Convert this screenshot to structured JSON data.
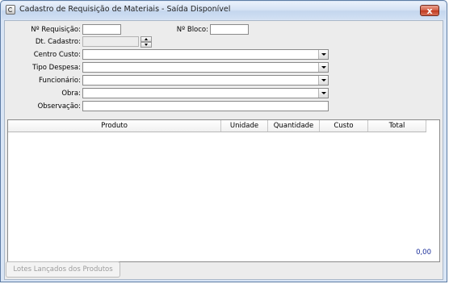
{
  "window": {
    "title": "Cadastro de Requisição de Materiais - Saída Disponível",
    "close_label": "x"
  },
  "form": {
    "requisicao_label": "Nº Requisição:",
    "bloco_label": "Nº Bloco:",
    "cadastro_label": "Dt. Cadastro:",
    "centro_custo_label": "Centro Custo:",
    "tipo_despesa_label": "Tipo Despesa:",
    "funcionario_label": "Funcionário:",
    "obra_label": "Obra:",
    "observacao_label": "Observação:",
    "requisicao_value": "",
    "bloco_value": "",
    "cadastro_value": "",
    "centro_custo_value": "",
    "tipo_despesa_value": "",
    "funcionario_value": "",
    "obra_value": "",
    "observacao_value": ""
  },
  "grid": {
    "columns": [
      "Produto",
      "Unidade",
      "Quantidade",
      "Custo",
      "Total"
    ],
    "total_value": "0,00"
  },
  "buttons": {
    "lotes_label": "Lotes Lançados dos Produtos"
  },
  "colors": {
    "title_bar": "#d6e3f5",
    "close_button": "#c0391f",
    "total_text": "#1b2f9a"
  }
}
